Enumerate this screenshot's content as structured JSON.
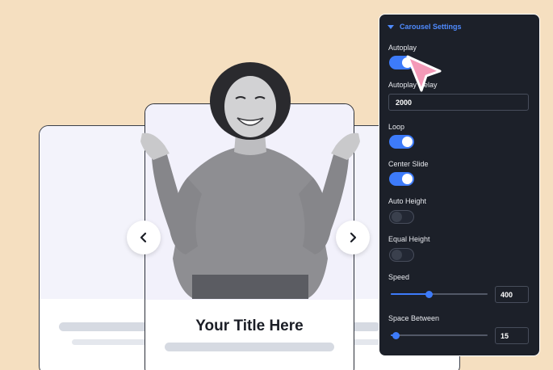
{
  "carousel": {
    "slide_title": "Your Title Here"
  },
  "panel": {
    "section_title": "Carousel Settings",
    "autoplay_label": "Autoplay",
    "autoplay_on": true,
    "autoplay_delay_label": "Autoplay Delay",
    "autoplay_delay_value": "2000",
    "loop_label": "Loop",
    "loop_on": true,
    "center_slide_label": "Center Slide",
    "center_slide_on": true,
    "auto_height_label": "Auto Height",
    "auto_height_on": false,
    "equal_height_label": "Equal Height",
    "equal_height_on": false,
    "speed_label": "Speed",
    "speed_value": "400",
    "space_between_label": "Space Between",
    "space_between_value": "15"
  },
  "colors": {
    "page_background": "#f5dfc0",
    "panel_background": "#1c2029",
    "accent": "#3d7bfa",
    "cursor": "#f49ab8"
  }
}
